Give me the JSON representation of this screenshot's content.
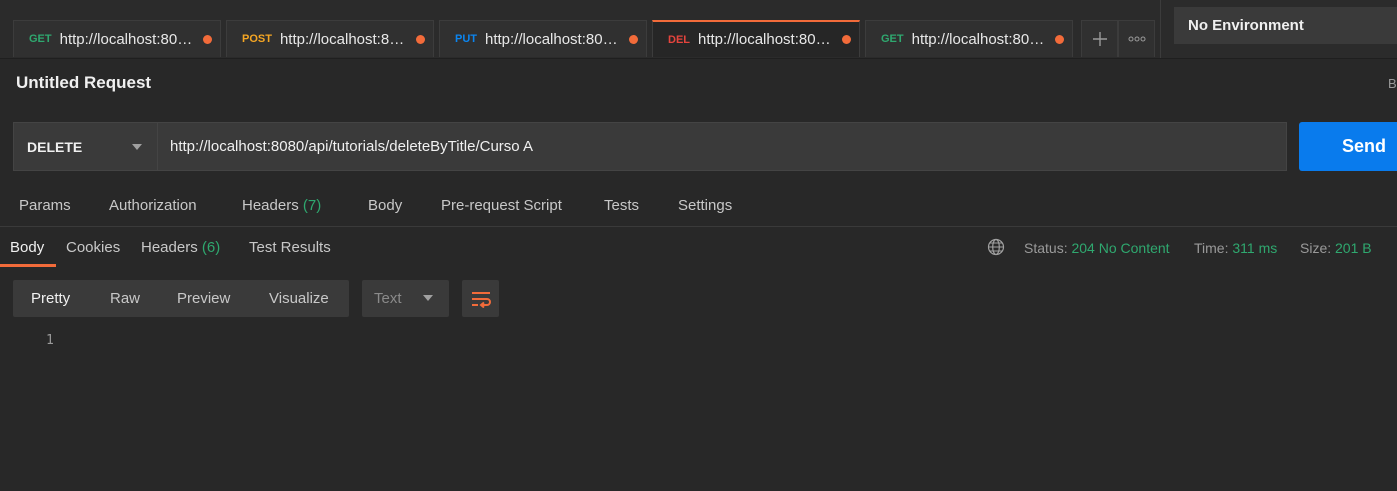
{
  "tabs": [
    {
      "method": "GET",
      "method_color": "#2fa86f",
      "url": "http://localhost:8080..."
    },
    {
      "method": "POST",
      "method_color": "#f5a623",
      "url": "http://localhost:808..."
    },
    {
      "method": "PUT",
      "method_color": "#0b85f0",
      "url": "http://localhost:8080..."
    },
    {
      "method": "DEL",
      "method_color": "#e5443d",
      "url": "http://localhost:8080..."
    },
    {
      "method": "GET",
      "method_color": "#2fa86f",
      "url": "http://localhost:8080..."
    }
  ],
  "environment": {
    "label": "No Environment"
  },
  "request": {
    "title": "Untitled Request",
    "right_cut_text": "B",
    "method": "DELETE",
    "url": "http://localhost:8080/api/tutorials/deleteByTitle/Curso A",
    "send_label": "Send"
  },
  "request_tabs": {
    "params": "Params",
    "authorization": "Authorization",
    "headers": "Headers",
    "headers_count": "(7)",
    "body": "Body",
    "prerequest": "Pre-request Script",
    "tests": "Tests",
    "settings": "Settings"
  },
  "response_tabs": {
    "body": "Body",
    "cookies": "Cookies",
    "headers": "Headers",
    "headers_count": "(6)",
    "test_results": "Test Results"
  },
  "response_meta": {
    "status_label": "Status:",
    "status_value": "204 No Content",
    "time_label": "Time:",
    "time_value": "311 ms",
    "size_label": "Size:",
    "size_value": "201 B"
  },
  "view_modes": {
    "pretty": "Pretty",
    "raw": "Raw",
    "preview": "Preview",
    "visualize": "Visualize",
    "format": "Text"
  },
  "editor": {
    "line_numbers": [
      "1"
    ]
  },
  "colors": {
    "accent": "#f26b3a",
    "send": "#097bed",
    "success": "#2fa86f"
  },
  "icons": {
    "new_tab": "plus-icon",
    "more": "more-dots-icon",
    "globe": "globe-icon",
    "wrap": "wrap-lines-icon"
  }
}
